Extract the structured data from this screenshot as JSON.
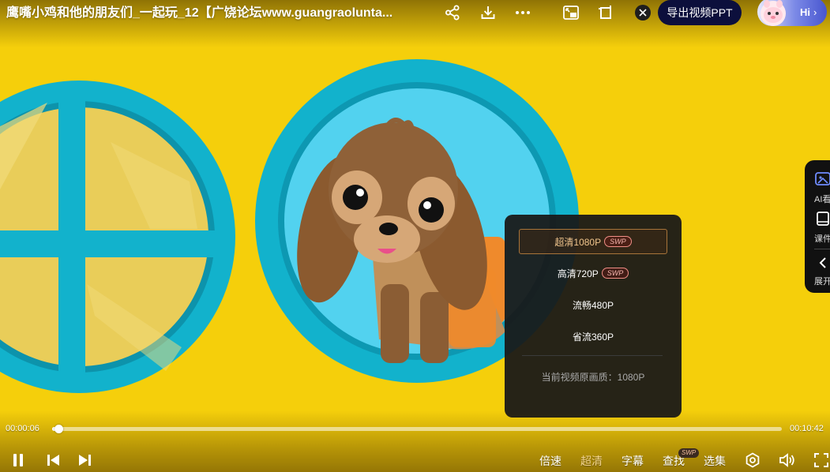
{
  "video": {
    "title": "鹰嘴小鸡和他的朋友们_一起玩_12【广饶论坛www.guangraolunta..."
  },
  "topbar": {
    "icons": [
      "share-icon",
      "download-icon",
      "more-icon",
      "picture-in-picture-icon",
      "crop-icon",
      "close-icon"
    ],
    "export_label": "导出视频PPT",
    "avatar_label": "Hi",
    "avatar_chevron": "›"
  },
  "side_panel": {
    "items": [
      {
        "label": "AI看",
        "icon": "ai-view-icon"
      },
      {
        "label": "课件",
        "icon": "courseware-icon"
      },
      {
        "label": "展开",
        "icon": "chevron-left-icon"
      }
    ]
  },
  "quality_menu": {
    "options": [
      {
        "label": "超清1080P",
        "badge": "SWP",
        "active": true
      },
      {
        "label": "高清720P",
        "badge": "SWP",
        "active": false
      },
      {
        "label": "流畅480P",
        "badge": "",
        "active": false
      },
      {
        "label": "省流360P",
        "badge": "",
        "active": false
      }
    ],
    "source_info": "当前视频原画质：1080P"
  },
  "player": {
    "current_time": "00:00:06",
    "total_time": "00:10:42",
    "progress_fraction": 0.009,
    "controls": {
      "speed_label": "倍速",
      "quality_label": "超清",
      "subtitle_label": "字幕",
      "search_label": "查找",
      "search_badge": "SWP",
      "episodes_label": "选集"
    }
  },
  "colors": {
    "background_yellow": "#f5cf0b",
    "porthole_teal": "#12b2cc",
    "active_quality": "#f0c48c",
    "badge_border": "#f08e86",
    "export_button": "#0c0f3c"
  }
}
